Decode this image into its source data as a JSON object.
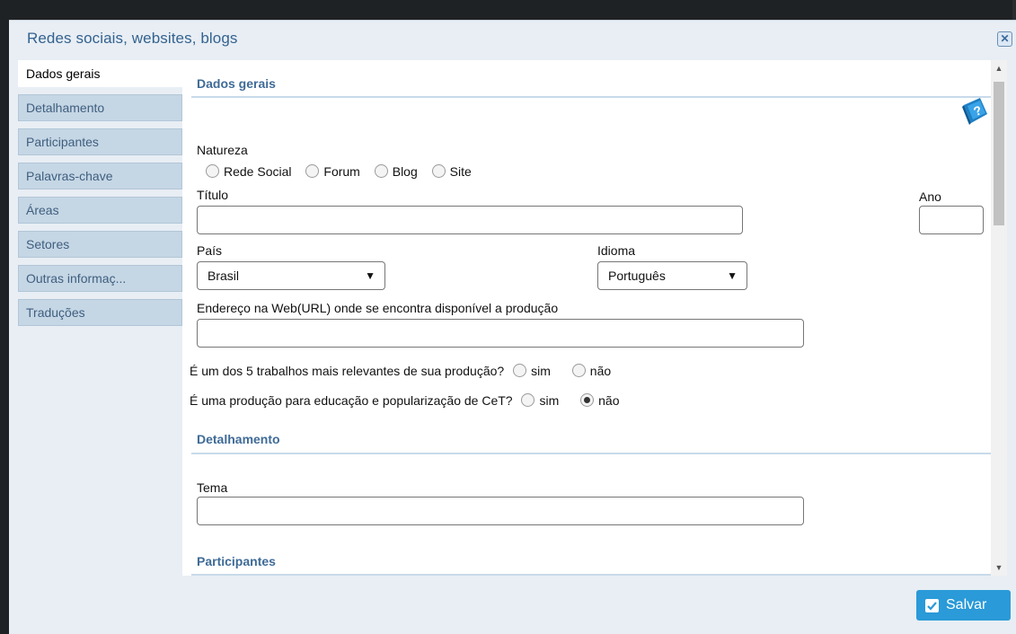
{
  "dialog": {
    "title": "Redes sociais, websites, blogs",
    "close_icon": "collapse-icon"
  },
  "tabs": [
    {
      "label": "Dados gerais",
      "active": true
    },
    {
      "label": "Detalhamento"
    },
    {
      "label": "Participantes"
    },
    {
      "label": "Palavras-chave"
    },
    {
      "label": "Áreas"
    },
    {
      "label": "Setores"
    },
    {
      "label": "Outras informaç..."
    },
    {
      "label": "Traduções"
    }
  ],
  "dados_gerais": {
    "section_title": "Dados gerais",
    "help_icon": "help-book-icon",
    "natureza": {
      "label": "Natureza",
      "options": [
        "Rede Social",
        "Forum",
        "Blog",
        "Site"
      ]
    },
    "titulo_label": "Título",
    "titulo_value": "",
    "ano_label": "Ano",
    "ano_value": "",
    "pais_label": "País",
    "pais_value": "Brasil",
    "idioma_label": "Idioma",
    "idioma_value": "Português",
    "url_label": "Endereço na Web(URL) onde se encontra disponível a produção",
    "url_value": "",
    "relevante": {
      "question": "É um dos 5 trabalhos mais relevantes de sua produção?",
      "sim": "sim",
      "nao": "não",
      "selected": "none"
    },
    "educacao": {
      "question": "É uma produção para educação e popularização de CeT?",
      "sim": "sim",
      "nao": "não",
      "selected": "não"
    }
  },
  "detalhamento": {
    "section_title": "Detalhamento",
    "tema_label": "Tema",
    "tema_value": ""
  },
  "participantes": {
    "section_title": "Participantes"
  },
  "footer": {
    "save_label": "Salvar",
    "save_icon": "checkbox-check-icon"
  },
  "colors": {
    "accent": "#2a9ad8",
    "title": "#34628f",
    "section": "#3f6b97",
    "tab_bg": "#c5d6e5"
  }
}
